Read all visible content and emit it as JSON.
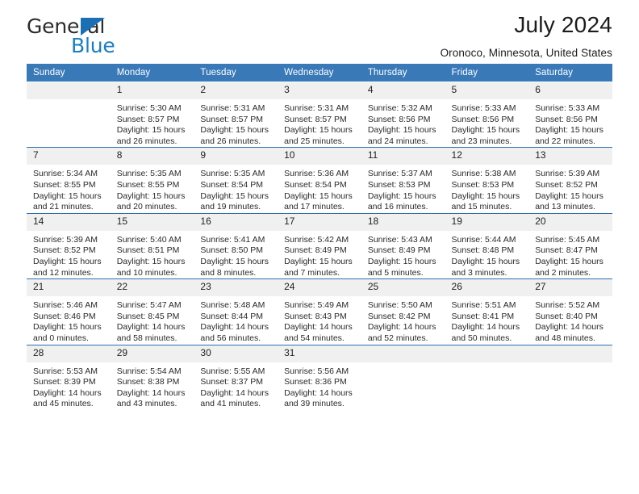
{
  "brand": {
    "name_part1": "General",
    "name_part2": "Blue",
    "logo_icon": "triangle-flag-icon",
    "colors": {
      "blue": "#1a7ec4",
      "dark": "#2b2b2b"
    }
  },
  "header": {
    "title": "July 2024",
    "subtitle": "Oronoco, Minnesota, United States"
  },
  "theme": {
    "header_row_bg": "#3a79b8",
    "daynum_bg": "#f0f0f0",
    "week_separator": "#2f6fae",
    "text": "#222222"
  },
  "calendar": {
    "weekday_headers": [
      "Sunday",
      "Monday",
      "Tuesday",
      "Wednesday",
      "Thursday",
      "Friday",
      "Saturday"
    ],
    "labels": {
      "sunrise": "Sunrise:",
      "sunset": "Sunset:",
      "daylight": "Daylight:"
    },
    "weeks": [
      [
        {
          "day": "",
          "sunrise": "",
          "sunset": "",
          "daylight_line1": "",
          "daylight_line2": ""
        },
        {
          "day": "1",
          "sunrise": "Sunrise: 5:30 AM",
          "sunset": "Sunset: 8:57 PM",
          "daylight_line1": "Daylight: 15 hours",
          "daylight_line2": "and 26 minutes."
        },
        {
          "day": "2",
          "sunrise": "Sunrise: 5:31 AM",
          "sunset": "Sunset: 8:57 PM",
          "daylight_line1": "Daylight: 15 hours",
          "daylight_line2": "and 26 minutes."
        },
        {
          "day": "3",
          "sunrise": "Sunrise: 5:31 AM",
          "sunset": "Sunset: 8:57 PM",
          "daylight_line1": "Daylight: 15 hours",
          "daylight_line2": "and 25 minutes."
        },
        {
          "day": "4",
          "sunrise": "Sunrise: 5:32 AM",
          "sunset": "Sunset: 8:56 PM",
          "daylight_line1": "Daylight: 15 hours",
          "daylight_line2": "and 24 minutes."
        },
        {
          "day": "5",
          "sunrise": "Sunrise: 5:33 AM",
          "sunset": "Sunset: 8:56 PM",
          "daylight_line1": "Daylight: 15 hours",
          "daylight_line2": "and 23 minutes."
        },
        {
          "day": "6",
          "sunrise": "Sunrise: 5:33 AM",
          "sunset": "Sunset: 8:56 PM",
          "daylight_line1": "Daylight: 15 hours",
          "daylight_line2": "and 22 minutes."
        }
      ],
      [
        {
          "day": "7",
          "sunrise": "Sunrise: 5:34 AM",
          "sunset": "Sunset: 8:55 PM",
          "daylight_line1": "Daylight: 15 hours",
          "daylight_line2": "and 21 minutes."
        },
        {
          "day": "8",
          "sunrise": "Sunrise: 5:35 AM",
          "sunset": "Sunset: 8:55 PM",
          "daylight_line1": "Daylight: 15 hours",
          "daylight_line2": "and 20 minutes."
        },
        {
          "day": "9",
          "sunrise": "Sunrise: 5:35 AM",
          "sunset": "Sunset: 8:54 PM",
          "daylight_line1": "Daylight: 15 hours",
          "daylight_line2": "and 19 minutes."
        },
        {
          "day": "10",
          "sunrise": "Sunrise: 5:36 AM",
          "sunset": "Sunset: 8:54 PM",
          "daylight_line1": "Daylight: 15 hours",
          "daylight_line2": "and 17 minutes."
        },
        {
          "day": "11",
          "sunrise": "Sunrise: 5:37 AM",
          "sunset": "Sunset: 8:53 PM",
          "daylight_line1": "Daylight: 15 hours",
          "daylight_line2": "and 16 minutes."
        },
        {
          "day": "12",
          "sunrise": "Sunrise: 5:38 AM",
          "sunset": "Sunset: 8:53 PM",
          "daylight_line1": "Daylight: 15 hours",
          "daylight_line2": "and 15 minutes."
        },
        {
          "day": "13",
          "sunrise": "Sunrise: 5:39 AM",
          "sunset": "Sunset: 8:52 PM",
          "daylight_line1": "Daylight: 15 hours",
          "daylight_line2": "and 13 minutes."
        }
      ],
      [
        {
          "day": "14",
          "sunrise": "Sunrise: 5:39 AM",
          "sunset": "Sunset: 8:52 PM",
          "daylight_line1": "Daylight: 15 hours",
          "daylight_line2": "and 12 minutes."
        },
        {
          "day": "15",
          "sunrise": "Sunrise: 5:40 AM",
          "sunset": "Sunset: 8:51 PM",
          "daylight_line1": "Daylight: 15 hours",
          "daylight_line2": "and 10 minutes."
        },
        {
          "day": "16",
          "sunrise": "Sunrise: 5:41 AM",
          "sunset": "Sunset: 8:50 PM",
          "daylight_line1": "Daylight: 15 hours",
          "daylight_line2": "and 8 minutes."
        },
        {
          "day": "17",
          "sunrise": "Sunrise: 5:42 AM",
          "sunset": "Sunset: 8:49 PM",
          "daylight_line1": "Daylight: 15 hours",
          "daylight_line2": "and 7 minutes."
        },
        {
          "day": "18",
          "sunrise": "Sunrise: 5:43 AM",
          "sunset": "Sunset: 8:49 PM",
          "daylight_line1": "Daylight: 15 hours",
          "daylight_line2": "and 5 minutes."
        },
        {
          "day": "19",
          "sunrise": "Sunrise: 5:44 AM",
          "sunset": "Sunset: 8:48 PM",
          "daylight_line1": "Daylight: 15 hours",
          "daylight_line2": "and 3 minutes."
        },
        {
          "day": "20",
          "sunrise": "Sunrise: 5:45 AM",
          "sunset": "Sunset: 8:47 PM",
          "daylight_line1": "Daylight: 15 hours",
          "daylight_line2": "and 2 minutes."
        }
      ],
      [
        {
          "day": "21",
          "sunrise": "Sunrise: 5:46 AM",
          "sunset": "Sunset: 8:46 PM",
          "daylight_line1": "Daylight: 15 hours",
          "daylight_line2": "and 0 minutes."
        },
        {
          "day": "22",
          "sunrise": "Sunrise: 5:47 AM",
          "sunset": "Sunset: 8:45 PM",
          "daylight_line1": "Daylight: 14 hours",
          "daylight_line2": "and 58 minutes."
        },
        {
          "day": "23",
          "sunrise": "Sunrise: 5:48 AM",
          "sunset": "Sunset: 8:44 PM",
          "daylight_line1": "Daylight: 14 hours",
          "daylight_line2": "and 56 minutes."
        },
        {
          "day": "24",
          "sunrise": "Sunrise: 5:49 AM",
          "sunset": "Sunset: 8:43 PM",
          "daylight_line1": "Daylight: 14 hours",
          "daylight_line2": "and 54 minutes."
        },
        {
          "day": "25",
          "sunrise": "Sunrise: 5:50 AM",
          "sunset": "Sunset: 8:42 PM",
          "daylight_line1": "Daylight: 14 hours",
          "daylight_line2": "and 52 minutes."
        },
        {
          "day": "26",
          "sunrise": "Sunrise: 5:51 AM",
          "sunset": "Sunset: 8:41 PM",
          "daylight_line1": "Daylight: 14 hours",
          "daylight_line2": "and 50 minutes."
        },
        {
          "day": "27",
          "sunrise": "Sunrise: 5:52 AM",
          "sunset": "Sunset: 8:40 PM",
          "daylight_line1": "Daylight: 14 hours",
          "daylight_line2": "and 48 minutes."
        }
      ],
      [
        {
          "day": "28",
          "sunrise": "Sunrise: 5:53 AM",
          "sunset": "Sunset: 8:39 PM",
          "daylight_line1": "Daylight: 14 hours",
          "daylight_line2": "and 45 minutes."
        },
        {
          "day": "29",
          "sunrise": "Sunrise: 5:54 AM",
          "sunset": "Sunset: 8:38 PM",
          "daylight_line1": "Daylight: 14 hours",
          "daylight_line2": "and 43 minutes."
        },
        {
          "day": "30",
          "sunrise": "Sunrise: 5:55 AM",
          "sunset": "Sunset: 8:37 PM",
          "daylight_line1": "Daylight: 14 hours",
          "daylight_line2": "and 41 minutes."
        },
        {
          "day": "31",
          "sunrise": "Sunrise: 5:56 AM",
          "sunset": "Sunset: 8:36 PM",
          "daylight_line1": "Daylight: 14 hours",
          "daylight_line2": "and 39 minutes."
        },
        {
          "day": "",
          "sunrise": "",
          "sunset": "",
          "daylight_line1": "",
          "daylight_line2": ""
        },
        {
          "day": "",
          "sunrise": "",
          "sunset": "",
          "daylight_line1": "",
          "daylight_line2": ""
        },
        {
          "day": "",
          "sunrise": "",
          "sunset": "",
          "daylight_line1": "",
          "daylight_line2": ""
        }
      ]
    ]
  }
}
